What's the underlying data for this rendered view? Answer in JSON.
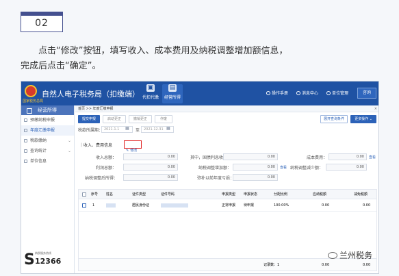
{
  "step": {
    "number": "02"
  },
  "instruction": {
    "line1": "点击“修改”按钮，填写收入、成本费用及纳税调整增加额信息，",
    "line2": "完成后点击“确定”。"
  },
  "titlebar": {
    "app_title": "自然人电子税务局（扣缴端）",
    "emblem_caption": "国家税务总局",
    "nav": [
      {
        "label": "代扣代缴"
      },
      {
        "label": "经营所得"
      }
    ],
    "links": [
      {
        "label": "操作手册"
      },
      {
        "label": "消息中心"
      },
      {
        "label": "单位管理"
      }
    ],
    "box_label": "咨询"
  },
  "sidebar": {
    "header": "经营所得",
    "items": [
      {
        "label": "预缴纳税申报"
      },
      {
        "label": "年度汇缴申报"
      },
      {
        "label": "税款缴纳"
      },
      {
        "label": "查询统计"
      },
      {
        "label": "单位信息"
      }
    ],
    "footer": {
      "caption": "纳税服务热线",
      "hotline": "12366"
    }
  },
  "breadcrumb": {
    "text": "首页 >> 年度汇缴申报",
    "close": "×"
  },
  "toolbar": {
    "buttons": [
      {
        "label": "提交申报"
      },
      {
        "label": "启动更正"
      },
      {
        "label": "撤销更正"
      },
      {
        "label": "作废"
      }
    ],
    "right_buttons": [
      {
        "label": "展开查询条件"
      },
      {
        "label": "更多操作"
      }
    ]
  },
  "period": {
    "label": "税款所属期：",
    "start": "2021.1.1",
    "sep": "至",
    "end": "2021.12.31"
  },
  "income_section": {
    "title": "收入、费用信息",
    "edit_label": "修改",
    "fields": [
      {
        "label": "收入总额：",
        "value": "0.00"
      },
      {
        "label": "其中，国债利息收入：",
        "value": "0.00"
      },
      {
        "label": "成本费用：",
        "value": "0.00",
        "link": "查看"
      },
      {
        "label": "利润总额：",
        "value": "0.00"
      },
      {
        "label": "纳税调整增加额：",
        "value": "0.00",
        "link": "查看"
      },
      {
        "label": "纳税调整减少额：",
        "value": "0.00"
      },
      {
        "label": "纳税调整后所得：",
        "value": "0.00"
      },
      {
        "label": "弥补以前年度亏损：",
        "value": "0.00"
      }
    ]
  },
  "table": {
    "headers": [
      "序号",
      "姓名",
      "证件类型",
      "证件号码",
      "申报类型",
      "申报状态",
      "分配比例",
      "应纳税额",
      "减免税额"
    ],
    "rows": [
      [
        "1",
        "",
        "居民身份证",
        "",
        "正常申报",
        "待申报",
        "100.00%",
        "0.00",
        "0.00"
      ]
    ],
    "footer_label": "记录数：1",
    "footer_values": [
      "0.00",
      "0.00"
    ]
  },
  "watermark": {
    "text": "兰州税务"
  }
}
